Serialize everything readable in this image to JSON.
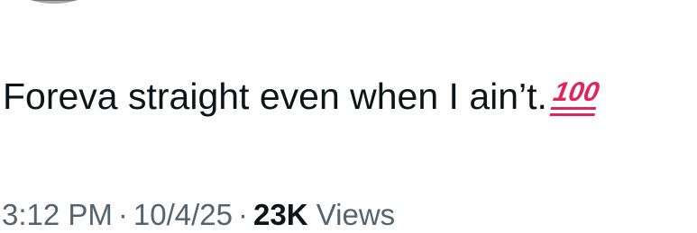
{
  "tweet": {
    "text": "Foreva straight even when I ain’t.",
    "emoji": "100",
    "time": "3:12 PM",
    "date": "10/4/25",
    "separator": "·",
    "views_count": "23K",
    "views_label": "Views"
  }
}
